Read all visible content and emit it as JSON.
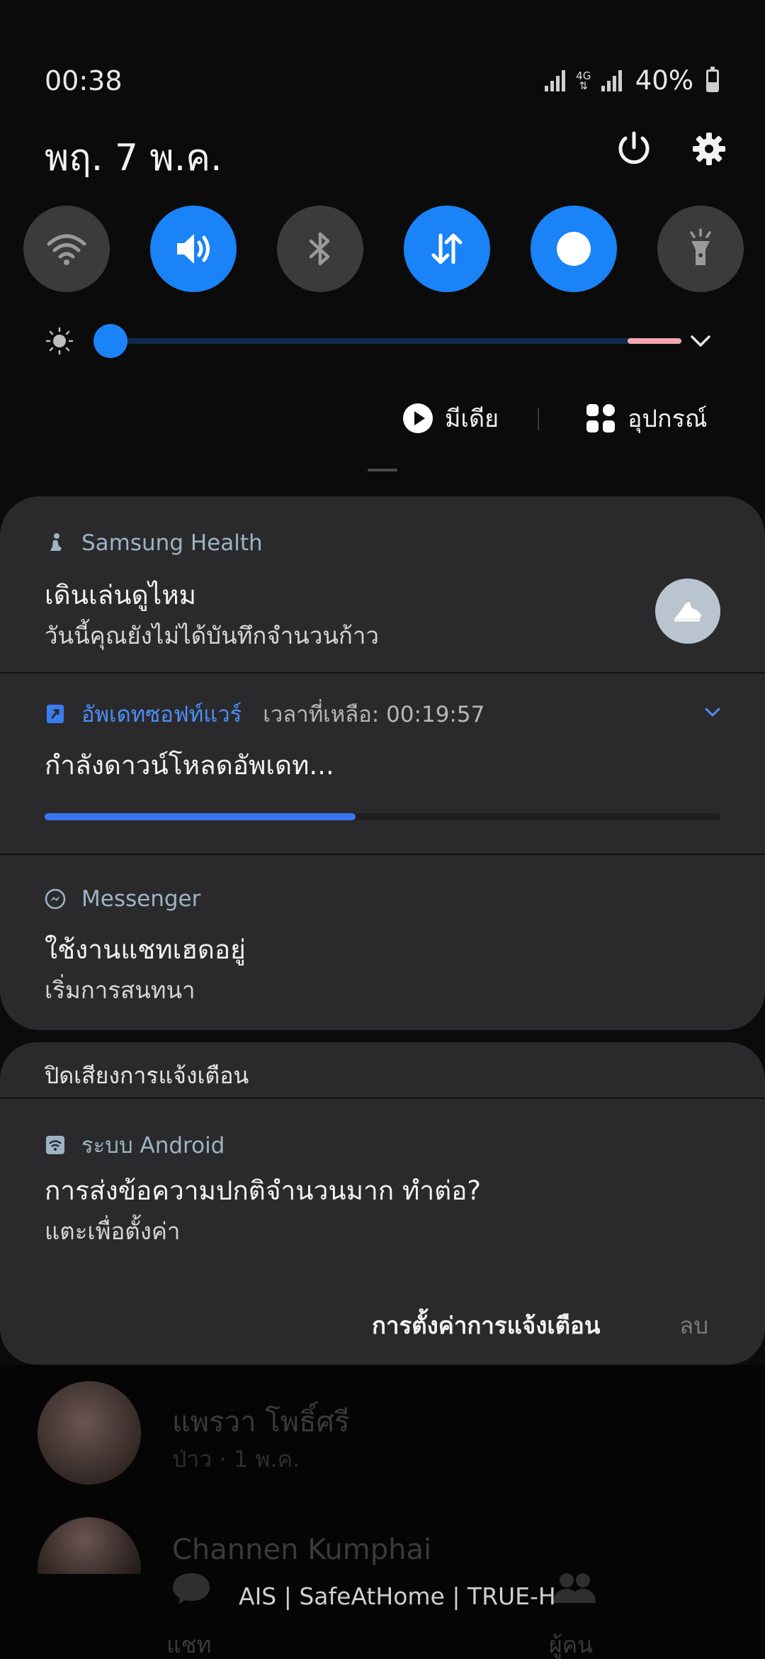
{
  "status": {
    "time": "00:38",
    "network_label": "4G",
    "battery": "40%"
  },
  "header": {
    "date": "พฤ. 7 พ.ค."
  },
  "quick_toggles": [
    {
      "name": "wifi",
      "on": false
    },
    {
      "name": "sound",
      "on": true
    },
    {
      "name": "bluetooth",
      "on": false
    },
    {
      "name": "mobile-data",
      "on": true
    },
    {
      "name": "auto-rotate",
      "on": true
    },
    {
      "name": "flashlight",
      "on": false
    }
  ],
  "brightness": {
    "level": 0.02
  },
  "media_row": {
    "media_label": "มีเดีย",
    "devices_label": "อุปกรณ์"
  },
  "notifications": {
    "health": {
      "app": "Samsung Health",
      "title": "เดินเล่นดูไหม",
      "body": "วันนี้คุณยังไม่ได้บันทึกจำนวนก้าว"
    },
    "update": {
      "app": "อัพเดทซอฟท์แวร์",
      "time_left": "เวลาที่เหลือ: 00:19:57",
      "title": "กำลังดาวน์โหลดอัพเดท...",
      "progress": 0.46
    },
    "messenger": {
      "app": "Messenger",
      "title": "ใช้งานแชทเฮดอยู่",
      "body": "เริ่มการสนทนา"
    },
    "silent_header": "ปิดเสียงการแจ้งเตือน",
    "android": {
      "app": "ระบบ Android",
      "title": "การส่งข้อความปกติจำนวนมาก ทำต่อ?",
      "body": "แตะเพื่อตั้งค่า"
    }
  },
  "footer": {
    "settings_label": "การตั้งค่าการแจ้งเตือน",
    "clear_label": "ลบ"
  },
  "background_app": {
    "contacts": [
      {
        "name": "แพรวา โพธิ์ศรี",
        "meta": "ป่าว · 1 พ.ค."
      },
      {
        "name": "Channen Kumphai",
        "meta": ""
      }
    ],
    "carrier": "AIS | SafeAtHome | TRUE-H",
    "tabs": [
      "แชท",
      "ผู้คน"
    ]
  }
}
